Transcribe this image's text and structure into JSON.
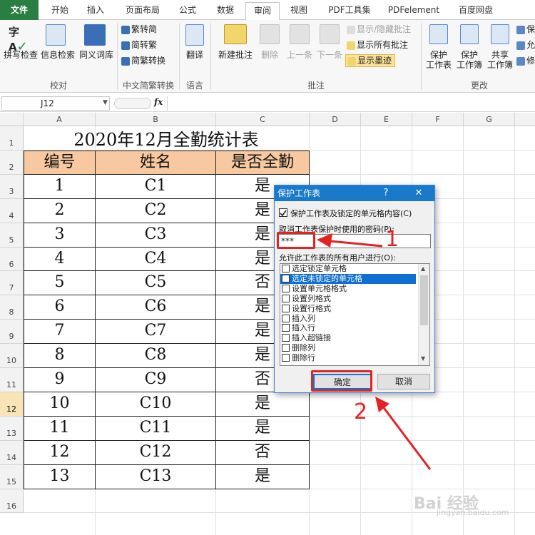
{
  "tabs": [
    {
      "label": "文件"
    },
    {
      "label": "开始"
    },
    {
      "label": "插入"
    },
    {
      "label": "页面布局"
    },
    {
      "label": "公式"
    },
    {
      "label": "数据"
    },
    {
      "label": "审阅"
    },
    {
      "label": "视图"
    },
    {
      "label": "PDF工具集"
    },
    {
      "label": "PDFelement"
    },
    {
      "label": "百度网盘"
    }
  ],
  "ribbon": {
    "spelling": "拼写检查",
    "research": "信息检索",
    "thesaurus": "同义词库",
    "group_proofing": "校对",
    "to_simplified": "繁转简",
    "to_traditional": "简转繁",
    "convert": "简繁转换",
    "group_chinese": "中文简繁转换",
    "translate": "翻译",
    "group_language": "语言",
    "new_comment": "新建批注",
    "delete": "删除",
    "previous": "上一条",
    "next": "下一条",
    "show_hide_comment": "显示/隐藏批注",
    "show_all_comments": "显示所有批注",
    "show_ink": "显示墨迹",
    "group_comments": "批注",
    "protect_sheet": [
      "保护",
      "工作表"
    ],
    "protect_workbook": [
      "保护",
      "工作簿"
    ],
    "share_workbook": [
      "共享",
      "工作簿"
    ],
    "group_changes": "更改",
    "extra1": "保",
    "extra2": "允",
    "extra3": "修"
  },
  "formula_bar": {
    "name_box": "J12",
    "fx": "fx",
    "formula": ""
  },
  "columns": [
    "A",
    "B",
    "C",
    "D",
    "E",
    "F",
    "G"
  ],
  "rows": [
    "1",
    "2",
    "3",
    "4",
    "5",
    "6",
    "7",
    "8",
    "9",
    "10",
    "11",
    "12",
    "13",
    "14",
    "15",
    "16"
  ],
  "sheet": {
    "title": "2020年12月全勤统计表",
    "headers": [
      "编号",
      "姓名",
      "是否全勤"
    ],
    "data": [
      [
        "1",
        "C1",
        "是"
      ],
      [
        "2",
        "C2",
        "是"
      ],
      [
        "3",
        "C3",
        "是"
      ],
      [
        "4",
        "C4",
        "是"
      ],
      [
        "5",
        "C5",
        "否"
      ],
      [
        "6",
        "C6",
        "是"
      ],
      [
        "7",
        "C7",
        "是"
      ],
      [
        "8",
        "C8",
        "是"
      ],
      [
        "9",
        "C9",
        "否"
      ],
      [
        "10",
        "C10",
        "是"
      ],
      [
        "11",
        "C11",
        "是"
      ],
      [
        "12",
        "C12",
        "否"
      ],
      [
        "13",
        "C13",
        "是"
      ]
    ]
  },
  "dialog": {
    "title": "保护工作表",
    "help": "?",
    "close": "✕",
    "protect_label": "保护工作表及锁定的单元格内容(C)",
    "password_label": "取消工作表保护时使用的密码(P):",
    "password_value": "***",
    "allow_label": "允许此工作表的所有用户进行(O):",
    "options": [
      "选定锁定单元格",
      "选定未锁定的单元格",
      "设置单元格格式",
      "设置列格式",
      "设置行格式",
      "插入列",
      "插入行",
      "插入超链接",
      "删除列",
      "删除行"
    ],
    "ok": "确定",
    "cancel": "取消"
  },
  "annotations": {
    "n1": "1",
    "n2": "2",
    "accent": "#e42222"
  },
  "watermark": {
    "main": "Bai 经验",
    "sub": "jingyan.baidu.com"
  }
}
